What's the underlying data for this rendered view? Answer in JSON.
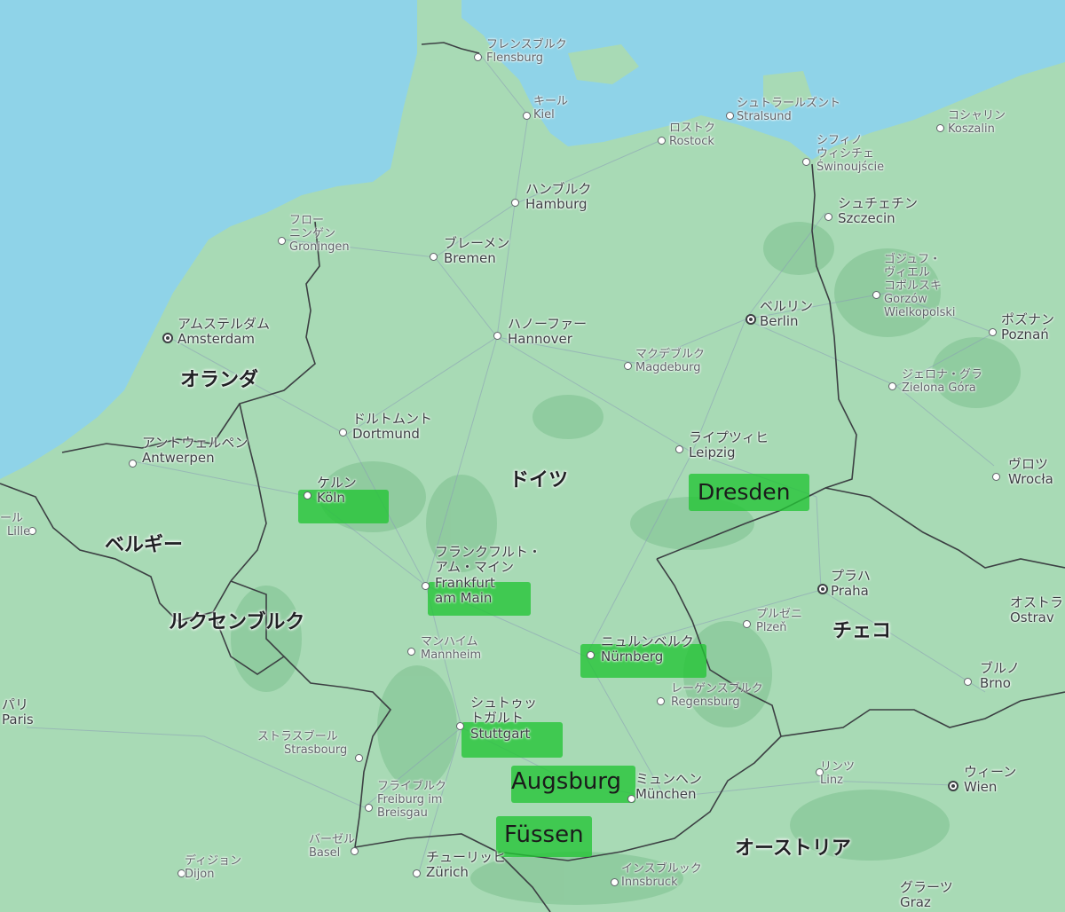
{
  "colors": {
    "sea": "#8fd3e8",
    "land": "#a8dab5",
    "forest": "#8cc99c",
    "border": "#3c4043",
    "highlight": "#22c435"
  },
  "countries": {
    "netherlands": "オランダ",
    "germany": "ドイツ",
    "belgium": "ベルギー",
    "luxembourg": "ルクセンブルク",
    "czech": "チェコ",
    "austria": "オーストリア"
  },
  "cities": {
    "flensburg": {
      "ja": "フレンスブルク",
      "en": "Flensburg"
    },
    "kiel": {
      "ja": "キール",
      "en": "Kiel"
    },
    "stralsund": {
      "ja": "シュトラールズント",
      "en": "Stralsund"
    },
    "rostock": {
      "ja": "ロストク",
      "en": "Rostock"
    },
    "koszalin": {
      "ja": "コシャリン",
      "en": "Koszalin"
    },
    "swinoujscie": {
      "ja": "シフィノ\nウィシチェ",
      "en": "Świnoujście"
    },
    "hamburg": {
      "ja": "ハンブルク",
      "en": "Hamburg"
    },
    "szczecin": {
      "ja": "シュチェチン",
      "en": "Szczecin"
    },
    "groningen": {
      "ja": "フロー\nニンゲン",
      "en": "Groningen"
    },
    "bremen": {
      "ja": "ブレーメン",
      "en": "Bremen"
    },
    "gorzow": {
      "ja": "ゴジュフ・\nヴィエル\nコポルスキ",
      "en": "Gorzów\nWielkopolski"
    },
    "berlin": {
      "ja": "ベルリン",
      "en": "Berlin"
    },
    "poznan": {
      "ja": "ポズナン",
      "en": "Poznań"
    },
    "amsterdam": {
      "ja": "アムステルダム",
      "en": "Amsterdam"
    },
    "hannover": {
      "ja": "ハノーファー",
      "en": "Hannover"
    },
    "magdeburg": {
      "ja": "マクデブルク",
      "en": "Magdeburg"
    },
    "zielona": {
      "ja": "ジェロナ・グラ",
      "en": "Zielona Góra"
    },
    "dortmund": {
      "ja": "ドルトムント",
      "en": "Dortmund"
    },
    "antwerpen": {
      "ja": "アントウェルペン",
      "en": "Antwerpen"
    },
    "leipzig": {
      "ja": "ライプツィヒ",
      "en": "Leipzig"
    },
    "wroclaw": {
      "ja": "ヴロツ",
      "en": "Wrocła"
    },
    "koln": {
      "ja": "ケルン",
      "en": "Köln"
    },
    "lille": {
      "ja": "ール",
      "en": "Lille"
    },
    "frankfurt": {
      "ja": "フランクフルト・\nアム・マイン",
      "en": "Frankfurt\nam Main"
    },
    "praha": {
      "ja": "プラハ",
      "en": "Praha"
    },
    "ostrava": {
      "ja": "オストラ",
      "en": "Ostrav"
    },
    "plzen": {
      "ja": "プルゼニ",
      "en": "Plzeň"
    },
    "mannheim": {
      "ja": "マンハイム",
      "en": "Mannheim"
    },
    "nurnberg": {
      "ja": "ニュルンベルク",
      "en": "Nürnberg"
    },
    "brno": {
      "ja": "ブルノ",
      "en": "Brno"
    },
    "regensburg": {
      "ja": "レーゲンスブルク",
      "en": "Regensburg"
    },
    "paris": {
      "ja": "パリ",
      "en": "Paris"
    },
    "strasbourg": {
      "ja": "ストラスブール",
      "en": "Strasbourg"
    },
    "stuttgart": {
      "ja": "シュトゥッ\nトガルト",
      "en": "Stuttgart"
    },
    "linz": {
      "ja": "リンツ",
      "en": "Linz"
    },
    "wien": {
      "ja": "ウィーン",
      "en": "Wien"
    },
    "munchen": {
      "ja": "ミュンヘン",
      "en": "München"
    },
    "freiburg": {
      "ja": "フライブルク",
      "en": "Freiburg im\nBreisgau"
    },
    "basel": {
      "ja": "バーゼル",
      "en": "Basel"
    },
    "dijon": {
      "ja": "ディジョン",
      "en": "Dijon"
    },
    "zurich": {
      "ja": "チューリッヒ",
      "en": "Zürich"
    },
    "innsbruck": {
      "ja": "インスブルック",
      "en": "Innsbruck"
    },
    "graz": {
      "ja": "グラーツ",
      "en": "Graz"
    }
  },
  "highlights": {
    "dresden": "Dresden",
    "koln": "Köln",
    "frankfurt": "Frankfurt",
    "nurnberg": "Nürnberg",
    "stuttgart": "Stuttgart",
    "augsburg": "Augsburg",
    "fussen": "Füssen"
  }
}
